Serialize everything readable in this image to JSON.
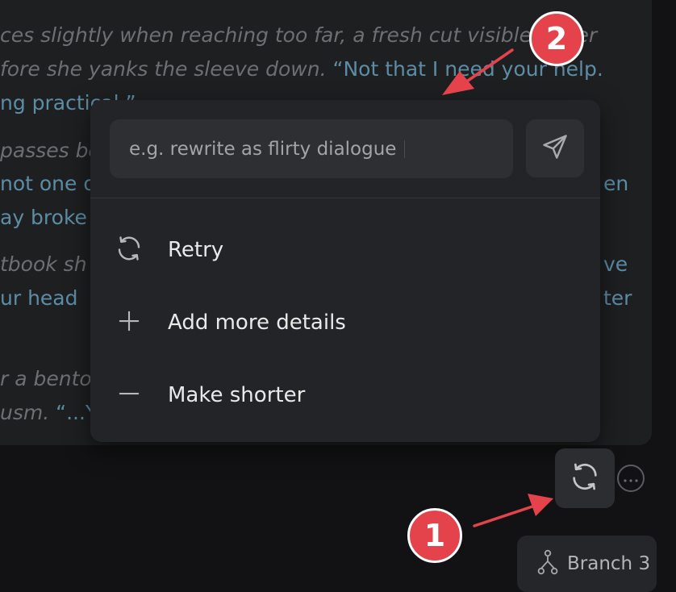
{
  "background_text": [
    {
      "segments": [
        {
          "text": "ces slightly when reaching too far, a fresh cut visible under",
          "quote": false
        }
      ]
    },
    {
      "segments": [
        {
          "text": "fore she yanks the sleeve down. ",
          "quote": false
        },
        {
          "text": "“Not that I need your help.",
          "quote": true
        }
      ]
    },
    {
      "segments": [
        {
          "text": "ng practical.”",
          "quote": true
        }
      ]
    },
    {
      "segments": [
        {
          "text": "passes be",
          "quote": false
        }
      ]
    },
    {
      "segments": [
        {
          "text": "not one o",
          "quote": true
        }
      ]
    },
    {
      "segments": [
        {
          "text": "ay broke",
          "quote": true
        }
      ]
    },
    {
      "segments": [
        {
          "text": "tbook sh",
          "quote": false
        }
      ]
    },
    {
      "segments": [
        {
          "text": "ur head",
          "quote": true
        }
      ]
    },
    {
      "segments": [
        {
          "text": "r a bento",
          "quote": false
        }
      ]
    },
    {
      "segments": [
        {
          "text": "usm. ",
          "quote": false
        },
        {
          "text": "“...Yo",
          "quote": true
        }
      ]
    }
  ],
  "background_right_text": [
    "en",
    "ve",
    "ter"
  ],
  "popup": {
    "prompt_placeholder": "e.g. rewrite as flirty dialogue",
    "send_icon": "send-icon",
    "menu_items": [
      {
        "label": "Retry",
        "icon": "refresh-icon"
      },
      {
        "label": "Add more details",
        "icon": "plus-icon"
      },
      {
        "label": "Make shorter",
        "icon": "minus-icon"
      }
    ]
  },
  "actions": {
    "regenerate_icon": "refresh-icon",
    "more_icon": "more-options-icon",
    "branch_label": "Branch 3",
    "branch_icon": "branch-icon"
  },
  "annotations": {
    "badge_1": "1",
    "badge_2": "2",
    "color": "#e5434b"
  },
  "colors": {
    "page_background": "#121214",
    "message_background": "#1e1f21",
    "popup_background": "#232427",
    "quote_text": "#5d8da5"
  }
}
